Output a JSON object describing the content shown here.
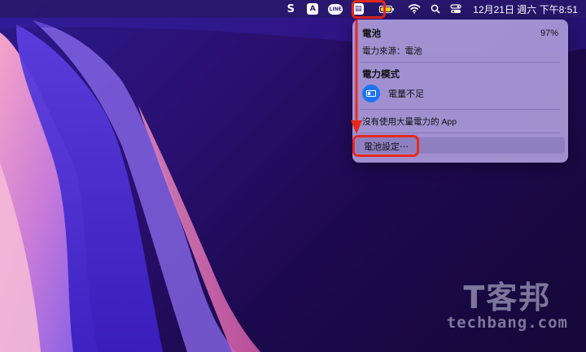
{
  "menubar": {
    "clock": "12月21日 週六 下午8:51",
    "icons": [
      "s-app-icon",
      "font-app-icon",
      "line-icon",
      "bank-app-icon",
      "battery-icon",
      "wifi-icon",
      "search-icon",
      "control-center-icon"
    ]
  },
  "battery_menu": {
    "title": "電池",
    "percent": "97%",
    "percent_value": 97,
    "power_source": "電力來源：電池",
    "power_mode_header": "電力模式",
    "power_mode_option": "電量不足",
    "no_heavy_apps": "沒有使用大量電力的 App",
    "settings_label": "電池設定⋯"
  },
  "watermark": {
    "logo": "T客邦",
    "site": "techbang.com"
  },
  "colors": {
    "highlight": "#e8281f",
    "battery_fill": "#f2d21b",
    "mode_icon": "#1d74f2"
  }
}
